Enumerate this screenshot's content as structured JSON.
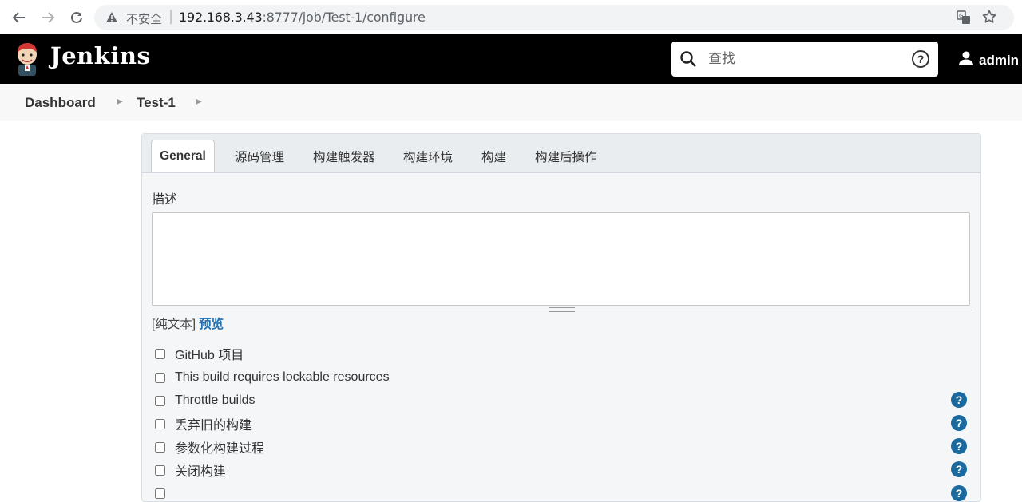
{
  "browser": {
    "insecure_label": "不安全",
    "url_host": "192.168.3.43",
    "url_rest": ":8777/job/Test-1/configure"
  },
  "header": {
    "title": "Jenkins",
    "search_placeholder": "查找",
    "user": "admin"
  },
  "breadcrumb": [
    "Dashboard",
    "Test-1"
  ],
  "tabs": [
    "General",
    "源码管理",
    "构建触发器",
    "构建环境",
    "构建",
    "构建后操作"
  ],
  "form": {
    "description_label": "描述",
    "description_value": "",
    "plain_text": "[纯文本]",
    "preview": "预览",
    "options": [
      {
        "label": "GitHub 项目",
        "help": false
      },
      {
        "label": "This build requires lockable resources",
        "help": false
      },
      {
        "label": "Throttle builds",
        "help": true
      },
      {
        "label": "丢弃旧的构建",
        "help": true
      },
      {
        "label": "参数化构建过程",
        "help": true
      },
      {
        "label": "关闭构建",
        "help": true
      }
    ]
  }
}
